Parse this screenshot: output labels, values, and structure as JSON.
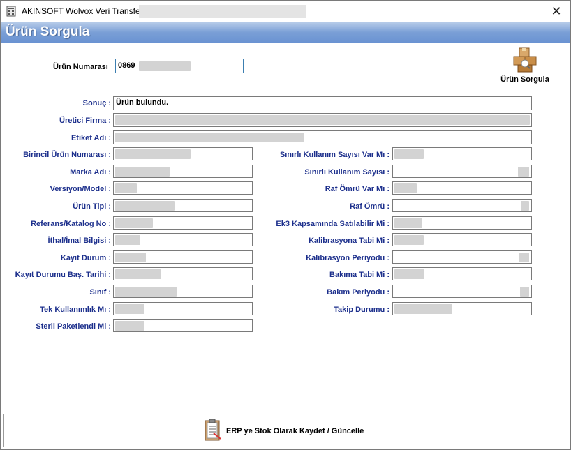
{
  "window": {
    "title": "AKINSOFT Wolvox Veri Transferi",
    "close_glyph": "✕"
  },
  "header": {
    "title": "Ürün Sorgula"
  },
  "search": {
    "label": "Ürün Numarası",
    "value": "0869",
    "button_label": "Ürün Sorgula",
    "button_icon": "boxes-icon"
  },
  "result": {
    "label": "Sonuç :",
    "value": "Ürün bulundu."
  },
  "fields": {
    "uretici_firma": "Üretici Firma :",
    "etiket_adi": "Etiket Adı :",
    "birincil": "Birincil Ürün Numarası :",
    "marka": "Marka Adı :",
    "versiyon": "Versiyon/Model :",
    "urun_tipi": "Ürün Tipi :",
    "referans": "Referans/Katalog No :",
    "ithal": "İthal/İmal Bilgisi :",
    "kayit_durum": "Kayıt Durum :",
    "kayit_tarihi": "Kayıt Durumu Baş. Tarihi :",
    "sinif": "Sınıf :",
    "tek_kullanimlik": "Tek Kullanımlık Mı :",
    "steril": "Steril Paketlendi Mi :",
    "sinirli_var": "Sınırlı Kullanım Sayısı Var Mı :",
    "sinirli_sayi": "Sınırlı Kullanım Sayısı :",
    "raf_omru_var": "Raf Ömrü Var Mı :",
    "raf_omru": "Raf Ömrü :",
    "ek3": "Ek3 Kapsamında Satılabilir Mi :",
    "kalibrasyon_tabi": "Kalibrasyona Tabi Mi :",
    "kalibrasyon_periyodu": "Kalibrasyon Periyodu :",
    "bakima_tabi": "Bakıma Tabi Mi :",
    "bakim_periyodu": "Bakım Periyodu :",
    "takip_durumu": "Takip Durumu :"
  },
  "footer": {
    "button_label": "ERP ye Stok Olarak Kaydet / Güncelle",
    "button_icon": "clipboard-icon"
  },
  "colors": {
    "header_gradient_top": "#b6cbe9",
    "header_gradient_bottom": "#6a93d2",
    "label_blue": "#1c2f8c"
  }
}
